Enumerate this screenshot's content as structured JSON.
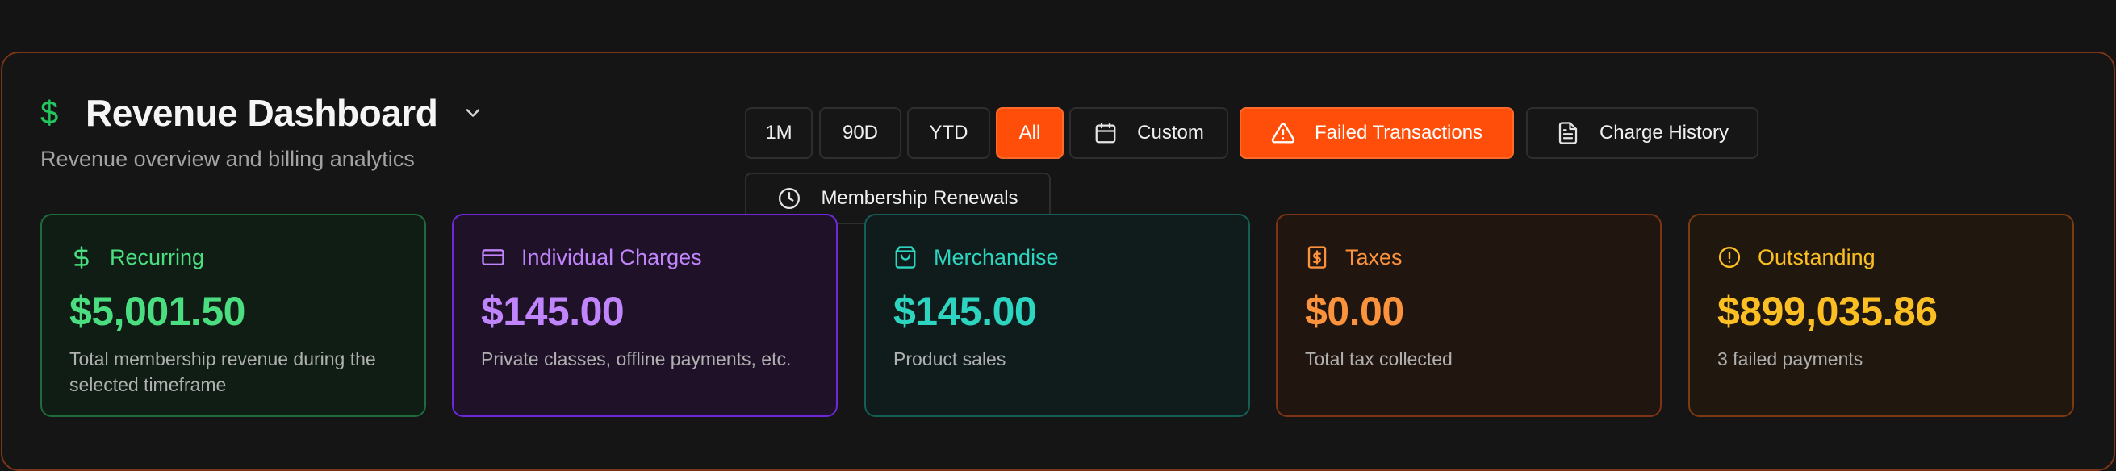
{
  "header": {
    "title": "Revenue Dashboard",
    "subtitle": "Revenue overview and billing analytics"
  },
  "toolbar": {
    "ranges": [
      {
        "label": "1M",
        "active": false
      },
      {
        "label": "90D",
        "active": false
      },
      {
        "label": "YTD",
        "active": false
      },
      {
        "label": "All",
        "active": true
      }
    ],
    "custom_label": "Custom",
    "failed_label": "Failed Transactions",
    "history_label": "Charge History",
    "renewals_label": "Membership Renewals"
  },
  "cards": [
    {
      "label": "Recurring",
      "value": "$5,001.50",
      "desc": "Total membership revenue during the selected timeframe",
      "icon": "dollar-icon",
      "accent": "#4ade80",
      "border": "#1f6b3c",
      "bg": "#0f1d14"
    },
    {
      "label": "Individual Charges",
      "value": "$145.00",
      "desc": "Private classes, offline payments, etc.",
      "icon": "credit-card-icon",
      "accent": "#c084fc",
      "border": "#6d28d9",
      "bg": "#1f1228"
    },
    {
      "label": "Merchandise",
      "value": "$145.00",
      "desc": "Product sales",
      "icon": "shopping-bag-icon",
      "accent": "#2dd4bf",
      "border": "#145e55",
      "bg": "#0f1c1b"
    },
    {
      "label": "Taxes",
      "value": "$0.00",
      "desc": "Total tax collected",
      "icon": "receipt-icon",
      "accent": "#fb923c",
      "border": "#7c3414",
      "bg": "#211510"
    },
    {
      "label": "Outstanding",
      "value": "$899,035.86",
      "desc": "3 failed payments",
      "icon": "alert-circle-icon",
      "accent": "#fbbf24",
      "border": "#7c3a12",
      "bg": "#20170e"
    }
  ],
  "colors": {
    "brand": "#ff4d0a",
    "title_icon": "#22c55e"
  }
}
